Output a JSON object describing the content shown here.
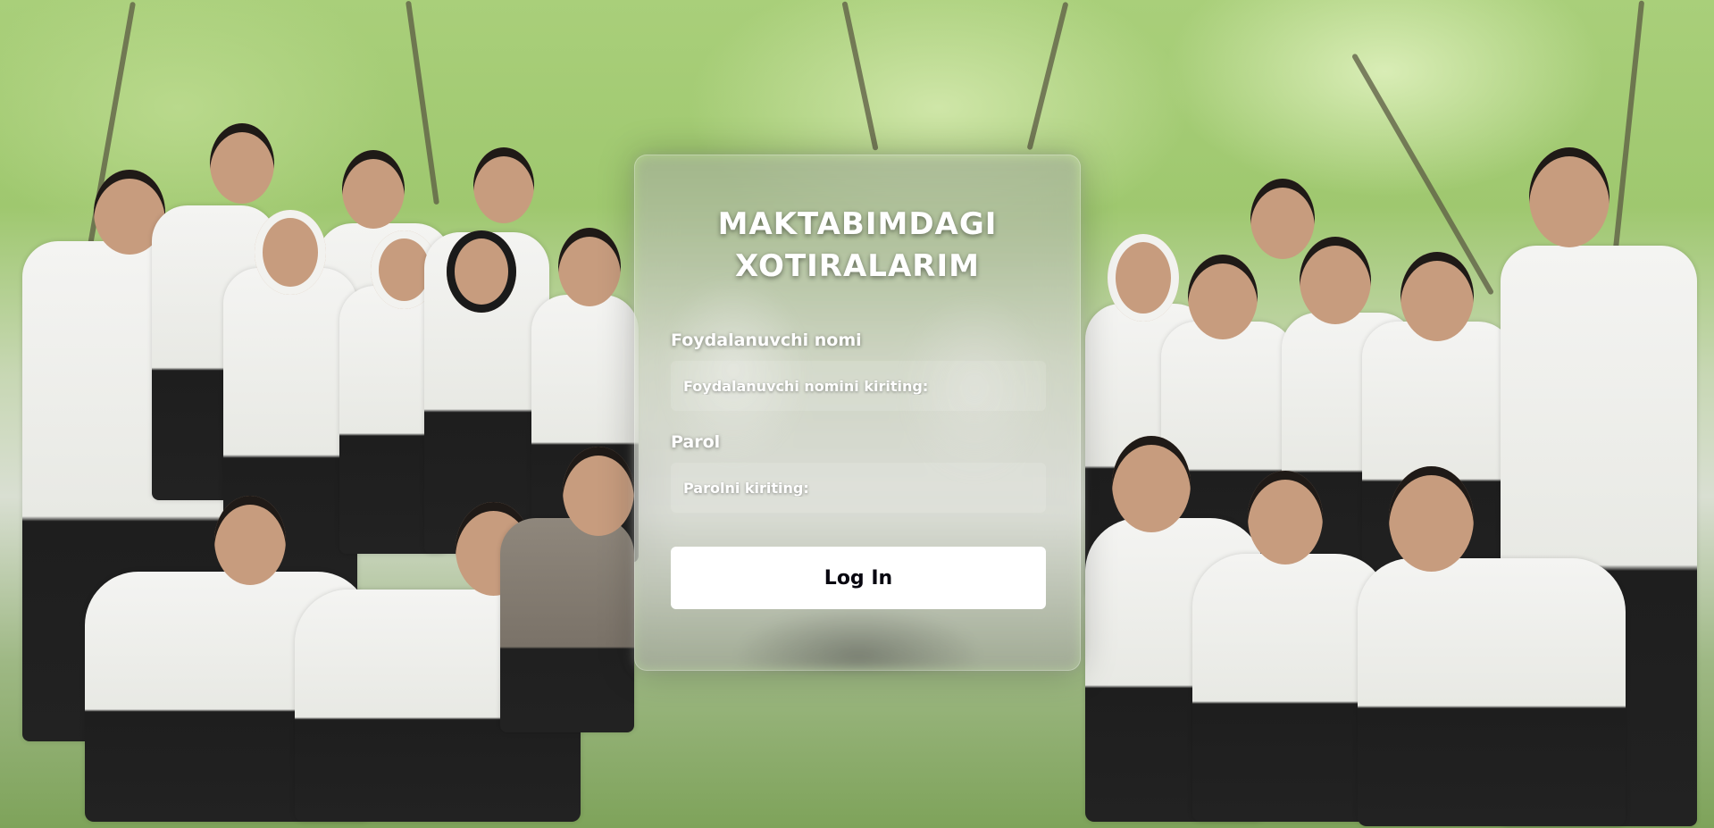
{
  "login": {
    "title_line1": "MAKTABIMDAGI",
    "title_line2": "XOTIRALARIM",
    "username_label": "Foydalanuvchi nomi",
    "username_placeholder": "Foydalanuvchi nomini kiriting:",
    "username_value": "",
    "password_label": "Parol",
    "password_placeholder": "Parolni kiriting:",
    "password_value": "",
    "login_button": "Log In"
  },
  "background": {
    "description_icon": "group-photo"
  },
  "colors": {
    "card_background": "rgba(255,255,255,0.18)",
    "button_background": "#ffffff",
    "button_text": "#080710",
    "text": "#ffffff"
  }
}
